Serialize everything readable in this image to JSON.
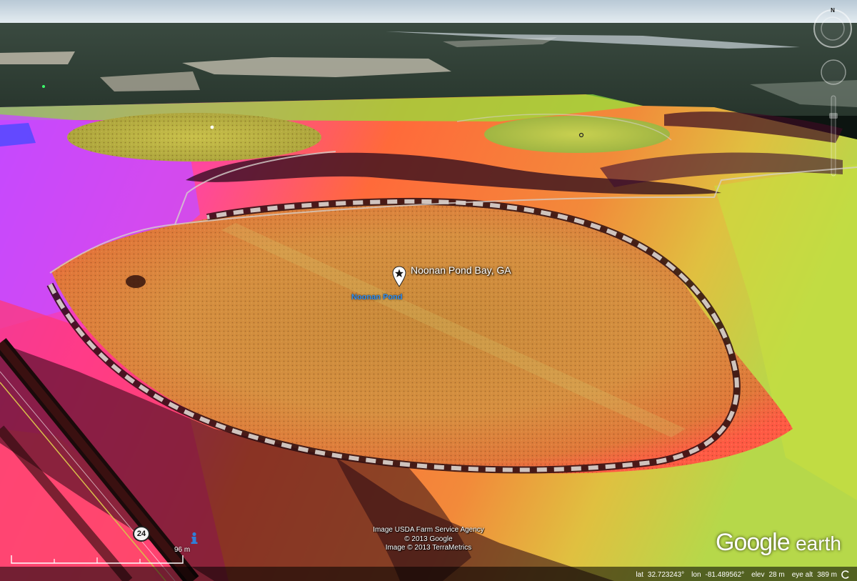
{
  "map": {
    "placemark": {
      "name": "Noonan Pond Bay, GA",
      "icon": "placemark-pin-icon"
    },
    "water_label": "Noonan Pond",
    "route_shield": "24",
    "info_icon": "info-icon"
  },
  "scale": {
    "label": "96 m"
  },
  "attribution": {
    "lines": [
      "Image USDA Farm Service Agency",
      "© 2013 Google",
      "Image © 2013 TerraMetrics"
    ]
  },
  "brand": {
    "logo_text": "Google",
    "logo_suffix": "earth"
  },
  "status": {
    "lat_label": "lat",
    "lat": "32.723243°",
    "lon_label": "lon",
    "lon": "-81.489562°",
    "elev_label": "elev",
    "elev": "28 m",
    "eye_alt_label": "eye alt",
    "eye_alt": "389 m"
  },
  "navigation": {
    "north_label": "N"
  },
  "colors": {
    "hot_pink": "#ff2fb4",
    "magenta": "#c43cff",
    "orange": "#f0a040",
    "gold": "#c9b24a",
    "green": "#9ee23a",
    "water_label": "#2f8df0"
  }
}
